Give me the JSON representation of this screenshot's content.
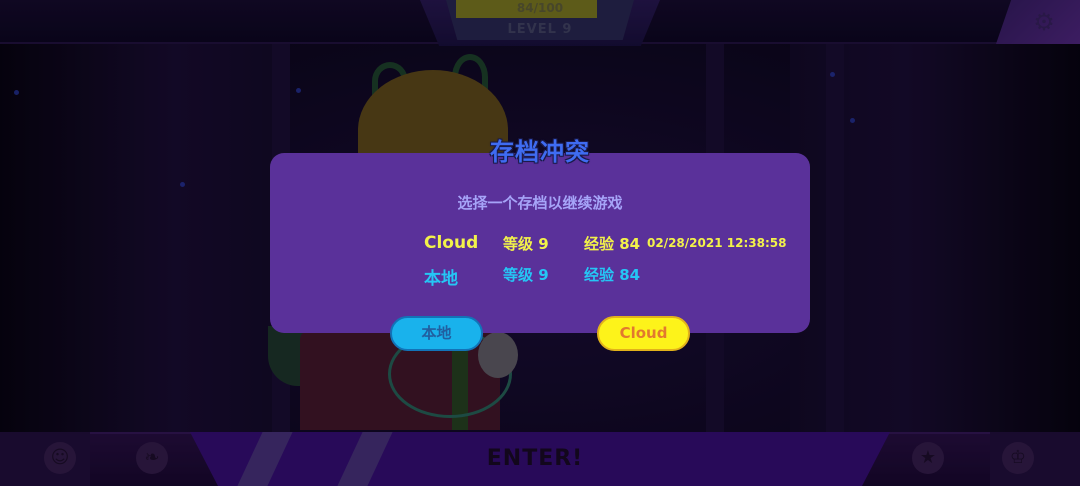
{
  "hud": {
    "xp_text": "84/100",
    "xp_fraction": 0.84,
    "level_text": "LEVEL 9",
    "enter_text": "ENTER!",
    "settings_icon": "gear-icon",
    "bottom_icons": [
      "profile-icon",
      "leaf-icon",
      "star-icon",
      "trophy-icon"
    ]
  },
  "dialog": {
    "title": "存档冲突",
    "subtitle": "选择一个存档以继续游戏",
    "cloud": {
      "source": "Cloud",
      "level": "等级  9",
      "exp": "经验  84",
      "timestamp": "02/28/2021 12:38:58"
    },
    "local": {
      "source": "本地",
      "level": "等级  9",
      "exp": "经验  84"
    },
    "buttons": {
      "local_label": "本地",
      "cloud_label": "Cloud"
    }
  },
  "colors": {
    "dialog_bg": "#5a319a",
    "title": "#3f6cf2",
    "cloud_text": "#f2f24a",
    "local_text": "#25c6f5",
    "local_button": "#19b2ec",
    "cloud_button": "#fdf31a"
  }
}
